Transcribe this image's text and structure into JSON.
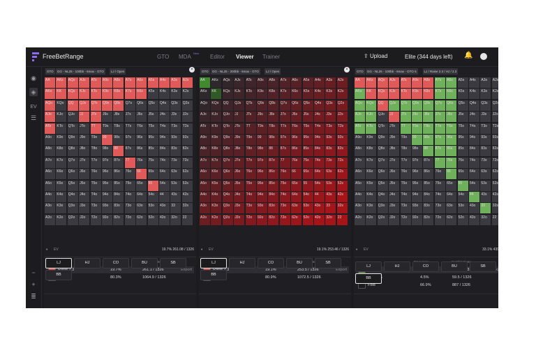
{
  "app": {
    "title": "FreeBetRange"
  },
  "nav": [
    {
      "label": "GTO",
      "active": false
    },
    {
      "label": "MDA",
      "active": false,
      "badge": "New"
    },
    {
      "label": "Editor",
      "active": false
    },
    {
      "label": "Viewer",
      "active": true
    },
    {
      "label": "Trainer",
      "active": false
    }
  ],
  "header": {
    "upload": "Upload",
    "plan": "Elite (344 days left)"
  },
  "sidebar": {
    "ev": "EV"
  },
  "colors": {
    "raise": "#e05a5a",
    "raise_dark": "#a51c1c",
    "call": "#6fb05a",
    "fold": "#3a3a40"
  },
  "ranks": [
    "A",
    "K",
    "Q",
    "J",
    "T",
    "9",
    "8",
    "7",
    "6",
    "5",
    "4",
    "3",
    "2"
  ],
  "panels": [
    {
      "tags": [
        "GTO",
        "GG - NL25 - 100bb - 6max - GTO",
        "LJ / Open"
      ],
      "mode": "freq",
      "ev_label": "EV",
      "summary": "19.7%  261.08 / 1326",
      "col_freq": "Frequency",
      "col_comb": "Combinations",
      "export": "Export",
      "actions": [
        {
          "name": "Raise 2.3",
          "freq": "19.7%",
          "comb": "261.1 / 1326",
          "color": "#e05a5a"
        },
        {
          "name": "Fold",
          "freq": "80.3%",
          "comb": "1064.9 / 1326",
          "color": "#1c1c1f"
        }
      ],
      "positions": [
        "LJ",
        "HJ",
        "CO",
        "BU",
        "SB",
        "BB"
      ],
      "selected": "LJ"
    },
    {
      "tags": [
        "GTO",
        "GG - NL25 - 200bb - 6max - GTO",
        "LJ / Open"
      ],
      "mode": "ev",
      "ev_label": "EV",
      "summary": "19.1%  253.46 / 1326",
      "col_freq": "Frequency",
      "col_comb": "Combinations",
      "export": "Export",
      "actions": [
        {
          "name": "Raise 2.3",
          "freq": "19.1%",
          "comb": "253.5 / 1326",
          "color": "#e05a5a"
        },
        {
          "name": "Fold",
          "freq": "80.9%",
          "comb": "1072.5 / 1326",
          "color": "#1c1c1f"
        }
      ],
      "positions": [
        "LJ",
        "HJ",
        "CO",
        "BU",
        "SB",
        "BB"
      ],
      "selected": "LJ"
    },
    {
      "tags": [
        "GTO",
        "GG - NL25 - 100bb - 6max - GTO 5",
        "LJ / Raise 2.3 / HJ / 2.3"
      ],
      "mode": "call",
      "ev_label": "EV",
      "summary": "33.1%  439 / 1",
      "col_freq": "Frequency",
      "col_comb": "Combinations",
      "export": "Expo",
      "actions": [
        {
          "name": "Call",
          "freq": "28.6%",
          "comb": "379.5 / 1326",
          "color": "#6fb05a"
        },
        {
          "name": "Raise 11",
          "freq": "4.5%",
          "comb": "59.5 / 1326",
          "color": "#e05a5a"
        },
        {
          "name": "Fold",
          "freq": "66.9%",
          "comb": "887 / 1326",
          "color": "#1c1c1f"
        }
      ],
      "positions": [
        "LJ",
        "HJ",
        "CO",
        "BU",
        "SB",
        "BB"
      ],
      "selected": "BB"
    }
  ]
}
